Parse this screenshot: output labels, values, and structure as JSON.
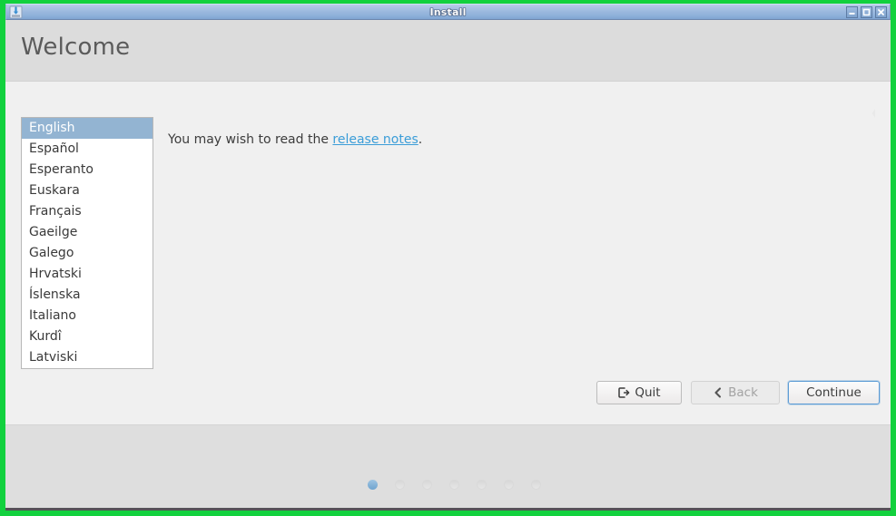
{
  "window": {
    "title": "Install",
    "icon": "install-package-icon",
    "controls": [
      {
        "name": "minimize",
        "glyph": "minimize-icon"
      },
      {
        "name": "maximize",
        "glyph": "maximize-icon"
      },
      {
        "name": "close",
        "glyph": "close-icon"
      }
    ]
  },
  "header": {
    "title": "Welcome"
  },
  "content": {
    "release_text_before": "You may wish to read the ",
    "release_link": "release notes",
    "release_text_after": "."
  },
  "languages": {
    "selected": "English",
    "items": [
      "English",
      "Español",
      "Esperanto",
      "Euskara",
      "Français",
      "Gaeilge",
      "Galego",
      "Hrvatski",
      "Íslenska",
      "Italiano",
      "Kurdî",
      "Latviski"
    ]
  },
  "buttons": {
    "quit": {
      "label": "Quit",
      "icon": "exit-icon",
      "state": "enabled"
    },
    "back": {
      "label": "Back",
      "icon": "chevron-left-icon",
      "state": "disabled"
    },
    "continue": {
      "label": "Continue",
      "state": "focused"
    }
  },
  "progress": {
    "total_steps": 7,
    "current_step": 1
  },
  "colors": {
    "frame_green": "#12d13e",
    "titlebar_blue": "#9ab8de",
    "selection_blue": "#93b4d2",
    "link_blue": "#3b9dd8",
    "focus_blue": "#5b9bd5",
    "dot_active_blue": "#6fa4cf",
    "header_gray": "#dcdcdc",
    "content_gray": "#f0f0f0",
    "bottom_gray": "#dedede"
  }
}
